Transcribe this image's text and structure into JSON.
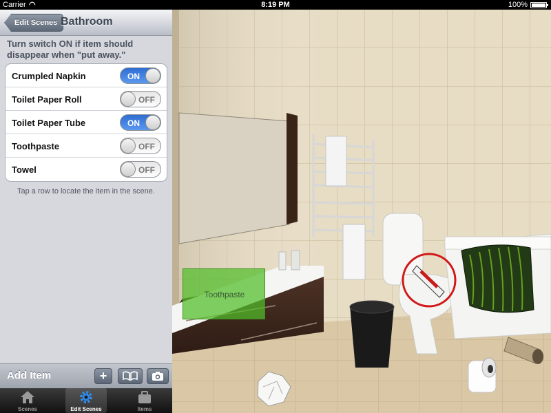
{
  "status_bar": {
    "carrier": "Carrier",
    "time": "8:19 PM",
    "battery": "100%"
  },
  "nav": {
    "back_label": "Edit Scenes",
    "title": "Bathroom"
  },
  "instructions": "Turn switch ON if item should disappear when \"put away.\"",
  "items": [
    {
      "label": "Crumpled Napkin",
      "state": "ON"
    },
    {
      "label": "Toilet Paper Roll",
      "state": "OFF"
    },
    {
      "label": "Toilet Paper Tube",
      "state": "ON"
    },
    {
      "label": "Toothpaste",
      "state": "OFF"
    },
    {
      "label": "Towel",
      "state": "OFF"
    }
  ],
  "hint": "Tap a row to locate the item in the scene.",
  "toolbar": {
    "add_label": "Add Item",
    "plus_icon": "plus-icon",
    "book_icon": "book-icon",
    "camera_icon": "camera-icon"
  },
  "tabs": [
    {
      "label": "Scenes",
      "icon": "house-icon",
      "active": false
    },
    {
      "label": "Edit Scenes",
      "icon": "gear-icon",
      "active": true
    },
    {
      "label": "Items",
      "icon": "briefcase-icon",
      "active": false
    }
  ],
  "scene": {
    "highlight_label": "Toothpaste",
    "highlight_color": "#50be28",
    "target_circle_color": "#d01818"
  }
}
